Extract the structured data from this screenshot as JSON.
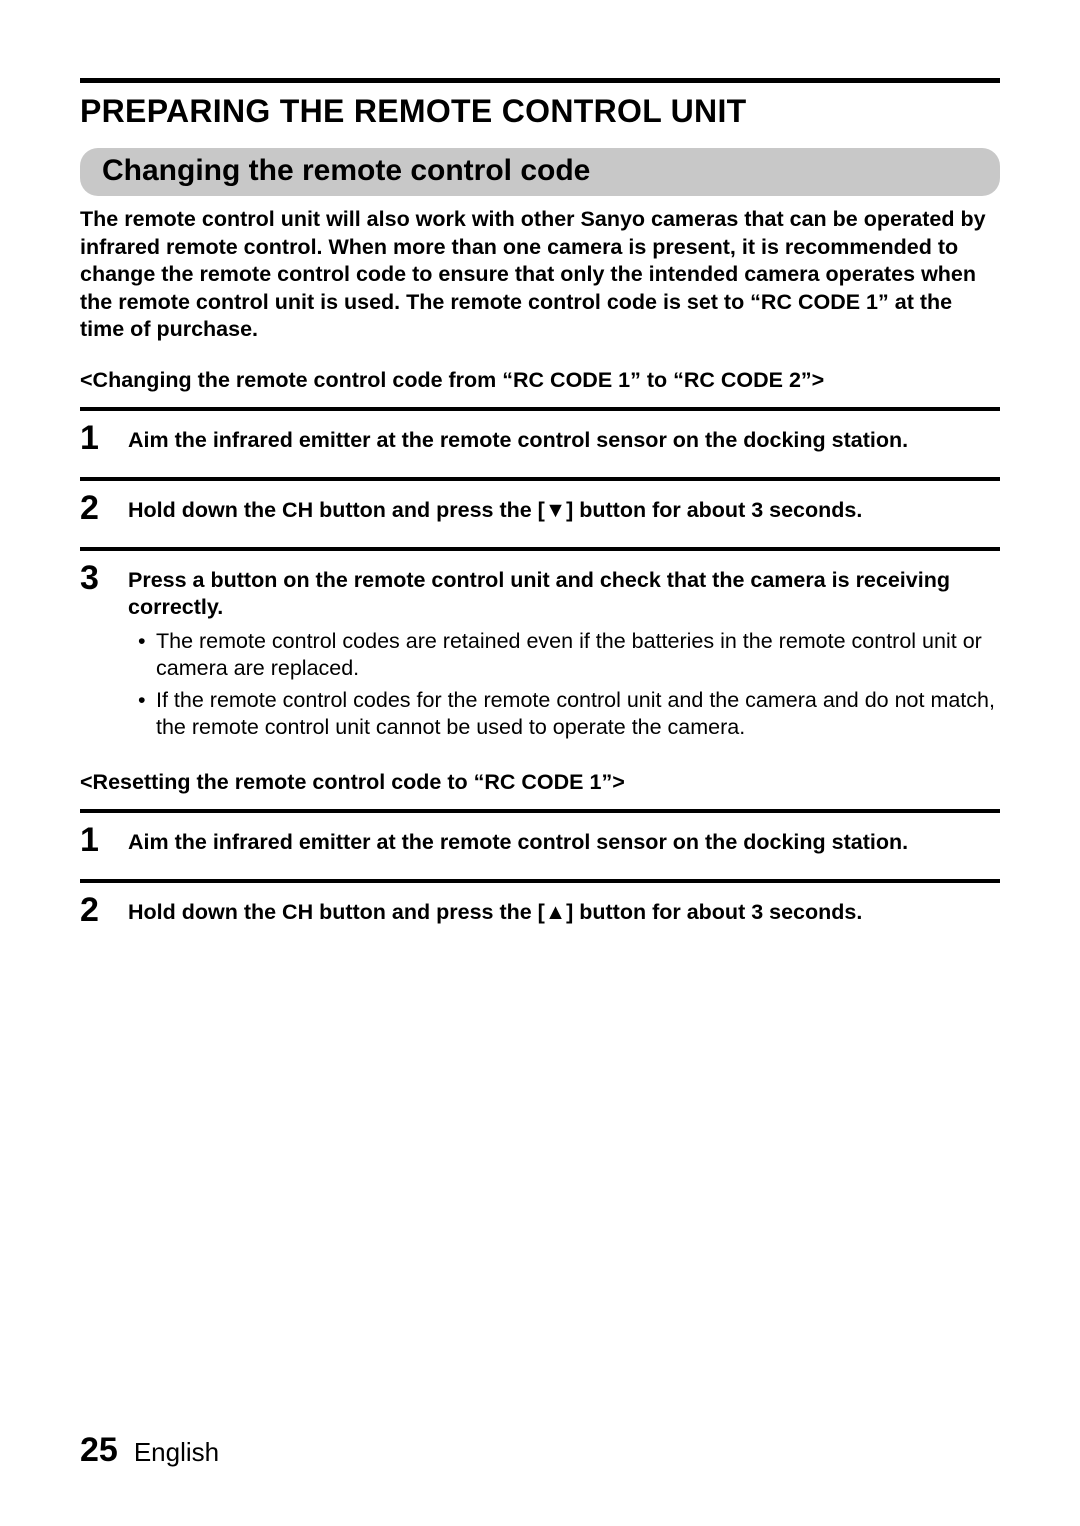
{
  "header": {
    "title": "PREPARING THE REMOTE CONTROL UNIT",
    "subhead": "Changing the remote control code"
  },
  "intro": "The remote control unit will also work with other Sanyo cameras that can be operated by infrared remote control. When more than one camera is present, it is recommended to change the remote control code to ensure that only the intended camera operates when the remote control unit is used. The remote control code is set to “RC CODE 1” at the time of purchase.",
  "sections": [
    {
      "label": "<Changing the remote control code from “RC CODE 1” to “RC CODE  2”>",
      "steps": [
        {
          "num": "1",
          "text": "Aim the infrared emitter at the remote control sensor on the docking station.",
          "bullets": []
        },
        {
          "num": "2",
          "text": "Hold down the CH button and press the [▼] button for about 3 seconds.",
          "bullets": []
        },
        {
          "num": "3",
          "text": "Press a button on the remote control unit and check that the camera is receiving correctly.",
          "bullets": [
            "The remote control codes are retained even if the batteries in the remote control unit or camera are replaced.",
            "If the remote control codes for the remote control unit and the camera and do not match, the remote control unit cannot be used to operate the camera."
          ]
        }
      ]
    },
    {
      "label": "<Resetting the remote control code to “RC CODE 1”>",
      "steps": [
        {
          "num": "1",
          "text": "Aim the infrared emitter at the remote control sensor on the docking station.",
          "bullets": []
        },
        {
          "num": "2",
          "text": "Hold down the CH button and press the [▲] button for about 3 seconds.",
          "bullets": []
        }
      ]
    }
  ],
  "footer": {
    "page": "25",
    "language": "English"
  }
}
